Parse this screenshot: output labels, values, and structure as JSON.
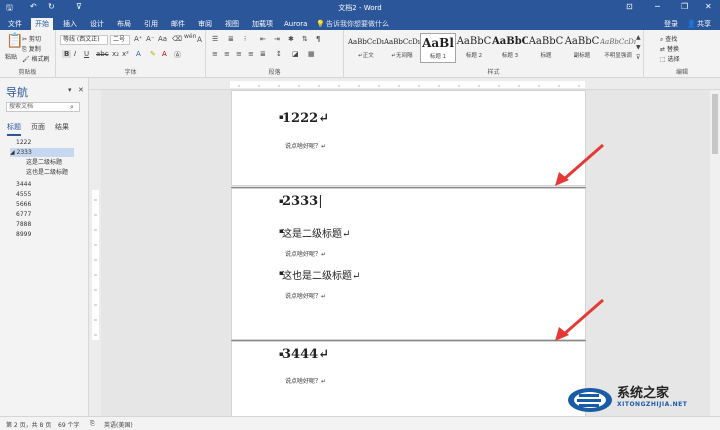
{
  "window": {
    "title": "文档2 - Word",
    "colors": {
      "accent": "#2b579a",
      "ribbon_bg": "#f3f3f3",
      "arrow": "#e53935"
    }
  },
  "quick_access": {
    "save_icon": "save-icon",
    "undo_icon": "undo-icon",
    "redo_icon": "redo-icon"
  },
  "window_controls": {
    "restore": "restore-icon",
    "minimize": "minimize-icon",
    "maximize": "maximize-icon",
    "close": "close-icon"
  },
  "tabs": [
    {
      "label": "文件",
      "active": false
    },
    {
      "label": "开始",
      "active": true
    },
    {
      "label": "插入",
      "active": false
    },
    {
      "label": "设计",
      "active": false
    },
    {
      "label": "布局",
      "active": false
    },
    {
      "label": "引用",
      "active": false
    },
    {
      "label": "邮件",
      "active": false
    },
    {
      "label": "审阅",
      "active": false
    },
    {
      "label": "视图",
      "active": false
    },
    {
      "label": "加载项",
      "active": false
    },
    {
      "label": "Aurora",
      "active": false
    }
  ],
  "tellme": "告诉我你想要做什么",
  "account": {
    "login": "登录",
    "share": "共享"
  },
  "ribbon": {
    "clipboard": {
      "label": "剪贴板",
      "paste": "粘贴",
      "cut": "剪切",
      "copy": "复制",
      "format_painter": "格式刷"
    },
    "font": {
      "label": "字体",
      "font_name": "等线 (西文正)",
      "font_size": "二号",
      "wen": "wén",
      "A": "A"
    },
    "paragraph": {
      "label": "段落"
    },
    "styles": {
      "label": "样式",
      "items": [
        {
          "preview": "AaBbCcDı",
          "name": "↵正文"
        },
        {
          "preview": "AaBbCcDı",
          "name": "↵无间隔"
        },
        {
          "preview": "AaBl",
          "name": "标题 1"
        },
        {
          "preview": "AaBbC",
          "name": "标题 2"
        },
        {
          "preview": "AaBbC",
          "name": "标题 3"
        },
        {
          "preview": "AaBbC",
          "name": "标题"
        },
        {
          "preview": "AaBbC",
          "name": "副标题"
        },
        {
          "preview": "AaBbCcDı",
          "name": "不明显强调"
        }
      ]
    },
    "editing": {
      "label": "编辑",
      "find": "查找",
      "replace": "替换",
      "select": "选择"
    }
  },
  "nav_pane": {
    "title": "导航",
    "search_placeholder": "搜索文档",
    "tabs": [
      {
        "label": "标题",
        "active": true
      },
      {
        "label": "页面",
        "active": false
      },
      {
        "label": "结果",
        "active": false
      }
    ],
    "items": [
      {
        "label": "1222",
        "level": 1,
        "selected": false
      },
      {
        "label": "◢ 2333",
        "level": 1,
        "selected": true
      },
      {
        "label": "这是二级标题",
        "level": 2,
        "selected": false
      },
      {
        "label": "这也是二级标题",
        "level": 2,
        "selected": false
      },
      {
        "label": "3444",
        "level": 1,
        "selected": false
      },
      {
        "label": "4555",
        "level": 1,
        "selected": false
      },
      {
        "label": "5666",
        "level": 1,
        "selected": false
      },
      {
        "label": "6777",
        "level": 1,
        "selected": false
      },
      {
        "label": "7888",
        "level": 1,
        "selected": false
      },
      {
        "label": "8999",
        "level": 1,
        "selected": false
      }
    ]
  },
  "document": {
    "page1": {
      "heading": "1222↵",
      "body": "说点啥好呢？↵"
    },
    "page2": {
      "heading": "2333",
      "sub1": "这是二级标题↵",
      "body1": "说点啥好呢？↵",
      "sub2": "这也是二级标题↵",
      "body2": "说点啥好呢？↵",
      "body0": "说点啥好呢？↵"
    },
    "page3": {
      "heading": "3444↵",
      "body": "说点啥好呢？↵"
    }
  },
  "statusbar": {
    "page": "第 2 页，共 8 页",
    "words": "69 个字",
    "lang": "英语(美国)"
  },
  "watermark": {
    "title": "系统之家",
    "url": "XITONGZHIJIA.NET"
  }
}
